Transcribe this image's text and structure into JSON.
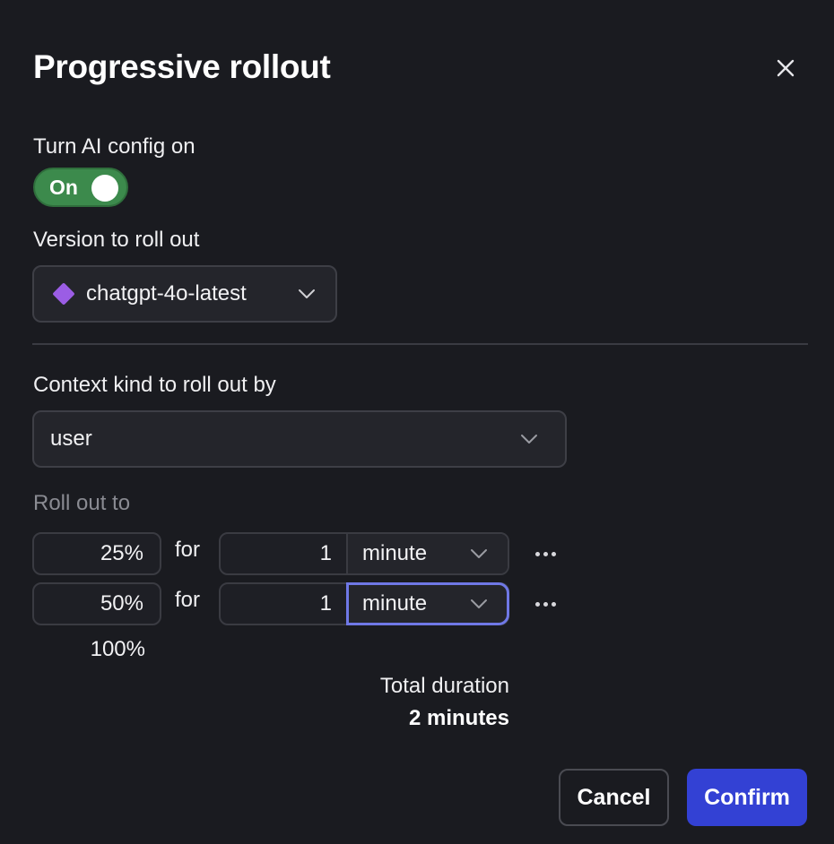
{
  "dialog": {
    "title": "Progressive rollout",
    "close_icon": "close-icon"
  },
  "toggle_section": {
    "label": "Turn AI config on",
    "toggle_label": "On",
    "state": true,
    "color": "#3c8a4c"
  },
  "version": {
    "label": "Version to roll out",
    "selected": "chatgpt-4o-latest",
    "icon": "diamond-icon",
    "icon_color": "#9b5de5"
  },
  "context": {
    "label": "Context kind to roll out by",
    "selected": "user"
  },
  "rollout": {
    "label": "Roll out to",
    "for_label": "for",
    "steps": [
      {
        "percent": "25%",
        "duration": "1",
        "unit": "minute",
        "focused": false
      },
      {
        "percent": "50%",
        "duration": "1",
        "unit": "minute",
        "focused": true
      }
    ],
    "final_percent": "100%"
  },
  "total": {
    "label": "Total duration",
    "value": "2 minutes"
  },
  "footer": {
    "cancel_label": "Cancel",
    "confirm_label": "Confirm",
    "confirm_color": "#3341d4"
  }
}
